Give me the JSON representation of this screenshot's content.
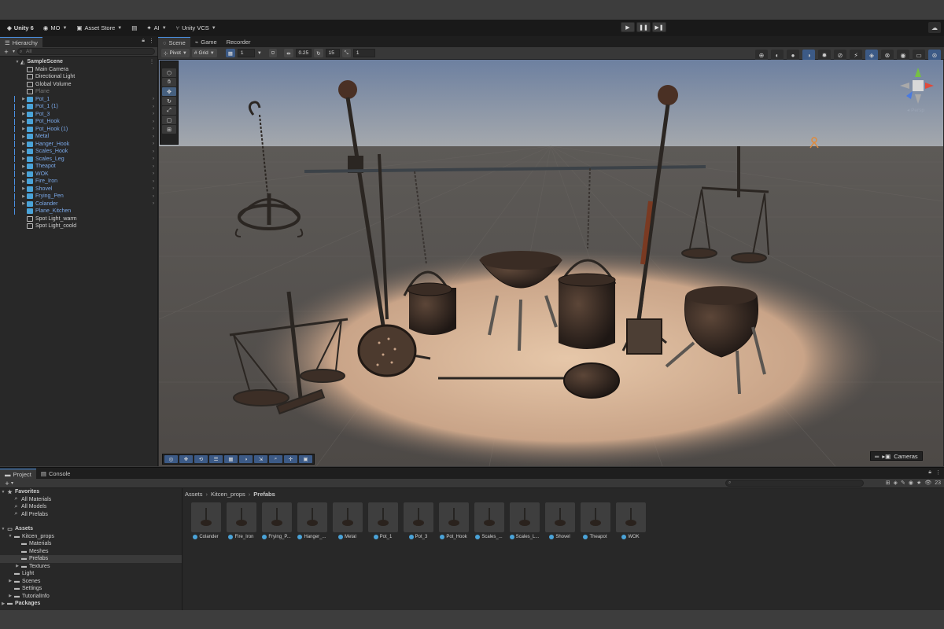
{
  "toolbar": {
    "account": "Unity 6",
    "user": "MO",
    "asset_store": "Asset Store",
    "ai": "AI",
    "vcs": "Unity VCS",
    "play_icon": "▶",
    "pause_icon": "❚❚",
    "step_icon": "▶❚"
  },
  "hierarchy": {
    "tab": "Hierarchy",
    "search_placeholder": "All",
    "scene_name": "SampleScene",
    "items": [
      {
        "label": "Main Camera",
        "style": "normal",
        "expandable": false
      },
      {
        "label": "Directional Light",
        "style": "normal",
        "expandable": false
      },
      {
        "label": "Global Volume",
        "style": "normal",
        "expandable": false
      },
      {
        "label": "Plane",
        "style": "dim",
        "expandable": false
      },
      {
        "label": "Pot_1",
        "style": "blue",
        "expandable": true
      },
      {
        "label": "Pot_1 (1)",
        "style": "blue",
        "expandable": true
      },
      {
        "label": "Pot_3",
        "style": "blue",
        "expandable": true
      },
      {
        "label": "Pot_Hook",
        "style": "blue",
        "expandable": true
      },
      {
        "label": "Pot_Hook (1)",
        "style": "blue",
        "expandable": true
      },
      {
        "label": "Metal",
        "style": "blue",
        "expandable": true
      },
      {
        "label": "Hanger_Hook",
        "style": "blue",
        "expandable": true
      },
      {
        "label": "Scales_Hook",
        "style": "blue",
        "expandable": true
      },
      {
        "label": "Scales_Leg",
        "style": "blue",
        "expandable": true
      },
      {
        "label": "Theapot",
        "style": "blue",
        "expandable": true
      },
      {
        "label": "WOK",
        "style": "blue",
        "expandable": true
      },
      {
        "label": "Fire_Iron",
        "style": "blue",
        "expandable": true
      },
      {
        "label": "Shovel",
        "style": "blue",
        "expandable": true
      },
      {
        "label": "Frying_Pen",
        "style": "blue",
        "expandable": true
      },
      {
        "label": "Colander",
        "style": "blue",
        "expandable": true
      },
      {
        "label": "Plane_Kitchen",
        "style": "blue",
        "expandable": false
      },
      {
        "label": "Spot Light_warm",
        "style": "normal",
        "expandable": false
      },
      {
        "label": "Spot Light_coold",
        "style": "normal",
        "expandable": false
      }
    ]
  },
  "scene": {
    "tabs": [
      "Scene",
      "Game",
      "Recorder"
    ],
    "pivot": "Pivot",
    "grid": "Grid",
    "grid_size": "1",
    "snap_value": "0.25",
    "rotate_snap": "15",
    "scale_snap": "1",
    "persp": "◂ Persp",
    "cameras": "Cameras"
  },
  "project": {
    "tabs": [
      "Project",
      "Console"
    ],
    "count": "23",
    "favorites": {
      "label": "Favorites",
      "items": [
        "All Materials",
        "All Models",
        "All Prefabs"
      ]
    },
    "assets_label": "Assets",
    "tree": [
      {
        "label": "Kitcen_props",
        "level": 1,
        "expanded": true
      },
      {
        "label": "Materials",
        "level": 2
      },
      {
        "label": "Meshes",
        "level": 2
      },
      {
        "label": "Prefabs",
        "level": 2,
        "selected": true
      },
      {
        "label": "Textures",
        "level": 2,
        "expandable": true
      },
      {
        "label": "Light",
        "level": 1
      },
      {
        "label": "Scenes",
        "level": 1,
        "expandable": true
      },
      {
        "label": "Settings",
        "level": 1
      },
      {
        "label": "TutorialInfo",
        "level": 1,
        "expandable": true
      }
    ],
    "packages_label": "Packages",
    "breadcrumb": [
      "Assets",
      "Kitcen_props",
      "Prefabs"
    ],
    "assets": [
      "Colander",
      "Fire_Iron",
      "Frying_P...",
      "Hanger_...",
      "Metal",
      "Pot_1",
      "Pot_3",
      "Pot_Hook",
      "Scales_...",
      "Scales_L...",
      "Shovel",
      "Theapot",
      "WOK"
    ]
  }
}
